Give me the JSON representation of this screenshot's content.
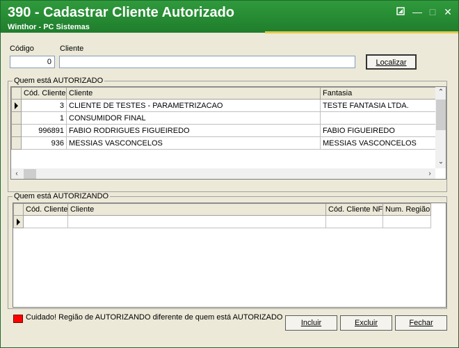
{
  "window": {
    "title": "390 - Cadastrar Cliente Autorizado",
    "subtitle": "Winthor - PC Sistemas",
    "controls": {
      "restore": "▪",
      "minimize": "—",
      "maximize": "□",
      "close": "✕"
    }
  },
  "search": {
    "codigo_label": "Código",
    "codigo_value": "0",
    "cliente_label": "Cliente",
    "cliente_value": "",
    "localizar_button": "Localizar"
  },
  "autorizado": {
    "group_title": "Quem está AUTORIZADO",
    "columns": [
      "Cód. Cliente",
      "Cliente",
      "Fantasia"
    ],
    "rows": [
      {
        "cod": "3",
        "cliente": "CLIENTE DE TESTES - PARAMETRIZACAO",
        "fantasia": "TESTE FANTASIA LTDA."
      },
      {
        "cod": "1",
        "cliente": "CONSUMIDOR FINAL",
        "fantasia": ""
      },
      {
        "cod": "996891",
        "cliente": "FABIO RODRIGUES FIGUEIREDO",
        "fantasia": "FABIO FIGUEIREDO"
      },
      {
        "cod": "936",
        "cliente": "MESSIAS VASCONCELOS",
        "fantasia": "MESSIAS VASCONCELOS"
      }
    ]
  },
  "autorizando": {
    "group_title": "Quem está AUTORIZANDO",
    "columns": [
      "Cód. Cliente",
      "Cliente",
      "Cód. Cliente NF",
      "Num. Região"
    ]
  },
  "footer": {
    "warning_text": "Cuidado! Região de AUTORIZANDO diferente de quem está AUTORIZADO",
    "warning_color": "#ff0000",
    "incluir_button": "Incluir",
    "excluir_button": "Excluir",
    "fechar_button": "Fechar"
  }
}
